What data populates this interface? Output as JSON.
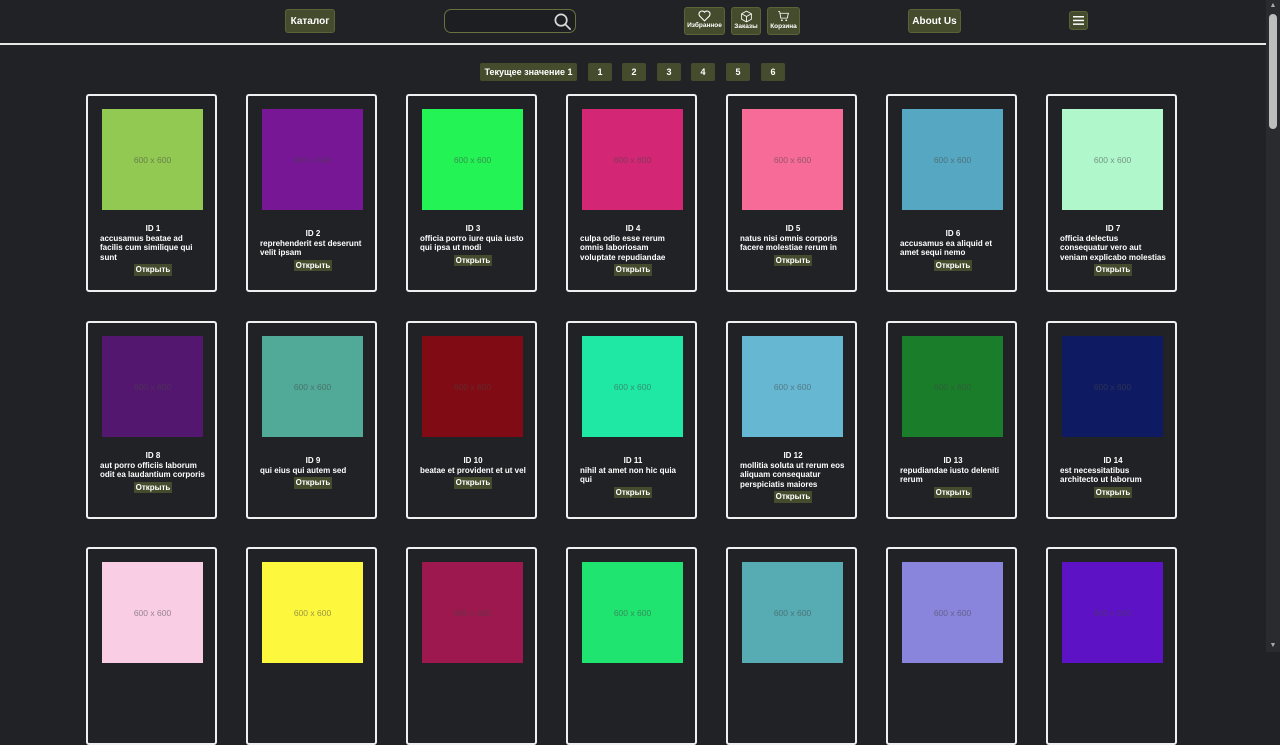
{
  "header": {
    "catalog_label": "Каталог",
    "search_placeholder": "",
    "favorites_label": "Избранное",
    "orders_label": "Заказы",
    "cart_label": "Корзина",
    "about_label": "About Us"
  },
  "pagination": {
    "current_label": "Текущее значение 1",
    "pages": [
      "1",
      "2",
      "3",
      "4",
      "5",
      "6"
    ]
  },
  "open_label": "Открыть",
  "placeholder_text": "600 x 600",
  "products": [
    {
      "id": "ID 1",
      "title": "accusamus beatae ad facilis cum similique qui sunt",
      "color": "#92c952"
    },
    {
      "id": "ID 2",
      "title": "reprehenderit est deserunt velit ipsam",
      "color": "#771796"
    },
    {
      "id": "ID 3",
      "title": "officia porro iure quia iusto qui ipsa ut modi",
      "color": "#24f355"
    },
    {
      "id": "ID 4",
      "title": "culpa odio esse rerum omnis laboriosam voluptate repudiandae",
      "color": "#d32776"
    },
    {
      "id": "ID 5",
      "title": "natus nisi omnis corporis facere molestiae rerum in",
      "color": "#f66b97"
    },
    {
      "id": "ID 6",
      "title": "accusamus ea aliquid et amet sequi nemo",
      "color": "#56a8c2"
    },
    {
      "id": "ID 7",
      "title": "officia delectus consequatur vero aut veniam explicabo molestias",
      "color": "#b0f7cc"
    },
    {
      "id": "ID 8",
      "title": "aut porro officiis laborum odit ea laudantium corporis",
      "color": "#54176f"
    },
    {
      "id": "ID 9",
      "title": "qui eius qui autem sed",
      "color": "#51aa97"
    },
    {
      "id": "ID 10",
      "title": "beatae et provident et ut vel",
      "color": "#810b14"
    },
    {
      "id": "ID 11",
      "title": "nihil at amet non hic quia qui",
      "color": "#1ee8a4"
    },
    {
      "id": "ID 12",
      "title": "mollitia soluta ut rerum eos aliquam consequatur perspiciatis maiores",
      "color": "#66b7d2"
    },
    {
      "id": "ID 13",
      "title": "repudiandae iusto deleniti rerum",
      "color": "#197d29"
    },
    {
      "id": "ID 14",
      "title": "est necessitatibus architecto ut laborum",
      "color": "#0e1b63"
    },
    {
      "id": "",
      "title": "",
      "color": "#f9cee5"
    },
    {
      "id": "",
      "title": "",
      "color": "#fdf73e"
    },
    {
      "id": "",
      "title": "",
      "color": "#9c184f"
    },
    {
      "id": "",
      "title": "",
      "color": "#1fe46f"
    },
    {
      "id": "",
      "title": "",
      "color": "#56acb2"
    },
    {
      "id": "",
      "title": "",
      "color": "#8985dc"
    },
    {
      "id": "",
      "title": "",
      "color": "#5e12c6"
    }
  ]
}
